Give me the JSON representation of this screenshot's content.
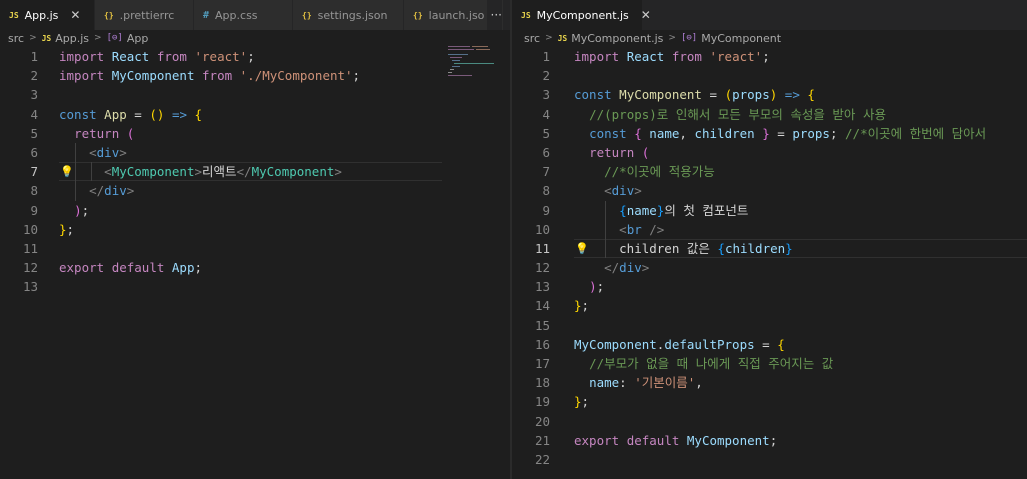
{
  "left": {
    "tabs": [
      {
        "icon": "JS",
        "label": "App.js",
        "active": true,
        "close": "✕"
      },
      {
        "icon": "{}",
        "label": ".prettierrc"
      },
      {
        "icon": "#",
        "label": "App.css"
      },
      {
        "icon": "{}",
        "label": "settings.json"
      },
      {
        "icon": "{}",
        "label": "launch.jso"
      }
    ],
    "more": "···",
    "breadcrumb": [
      "src",
      "App.js",
      "App"
    ],
    "line_numbers": [
      "1",
      "2",
      "3",
      "4",
      "5",
      "6",
      "7",
      "8",
      "9",
      "10",
      "11",
      "12",
      "13"
    ],
    "current_line": 7
  },
  "right": {
    "tabs": [
      {
        "icon": "JS",
        "label": "MyComponent.js",
        "active": true,
        "close": "✕"
      }
    ],
    "breadcrumb": [
      "src",
      "MyComponent.js",
      "MyComponent"
    ],
    "line_numbers": [
      "1",
      "2",
      "3",
      "4",
      "5",
      "6",
      "7",
      "8",
      "9",
      "10",
      "11",
      "12",
      "13",
      "14",
      "15",
      "16",
      "17",
      "18",
      "19",
      "20",
      "21",
      "22"
    ],
    "current_line": 11
  },
  "code": {
    "import": "import",
    "from": "from",
    "const": "const",
    "return": "return",
    "export": "export",
    "default": "default",
    "react_id": "React",
    "react_str": "'react'",
    "mycomp": "MyComponent",
    "mycomp_str": "'./MyComponent'",
    "app": "App",
    "arrow": "=>",
    "div": "div",
    "br": "br",
    "jsx_text_left": "리액트",
    "props": "props",
    "name": "name",
    "children": "children",
    "comment_4": "//(props)로 인해서 모든 부모의 속성을 받아 사용",
    "comment_5": "//*이곳에 한번에 담아서",
    "comment_7": "//*이곳에 적용가능",
    "text_9": "의 첫 컴포넌트",
    "text_11": "children 값은 ",
    "defaultProps": "defaultProps",
    "comment_17": "//부모가 없을 때 나에게 직접 주어지는 값",
    "default_name_str": "'기본이름'"
  }
}
